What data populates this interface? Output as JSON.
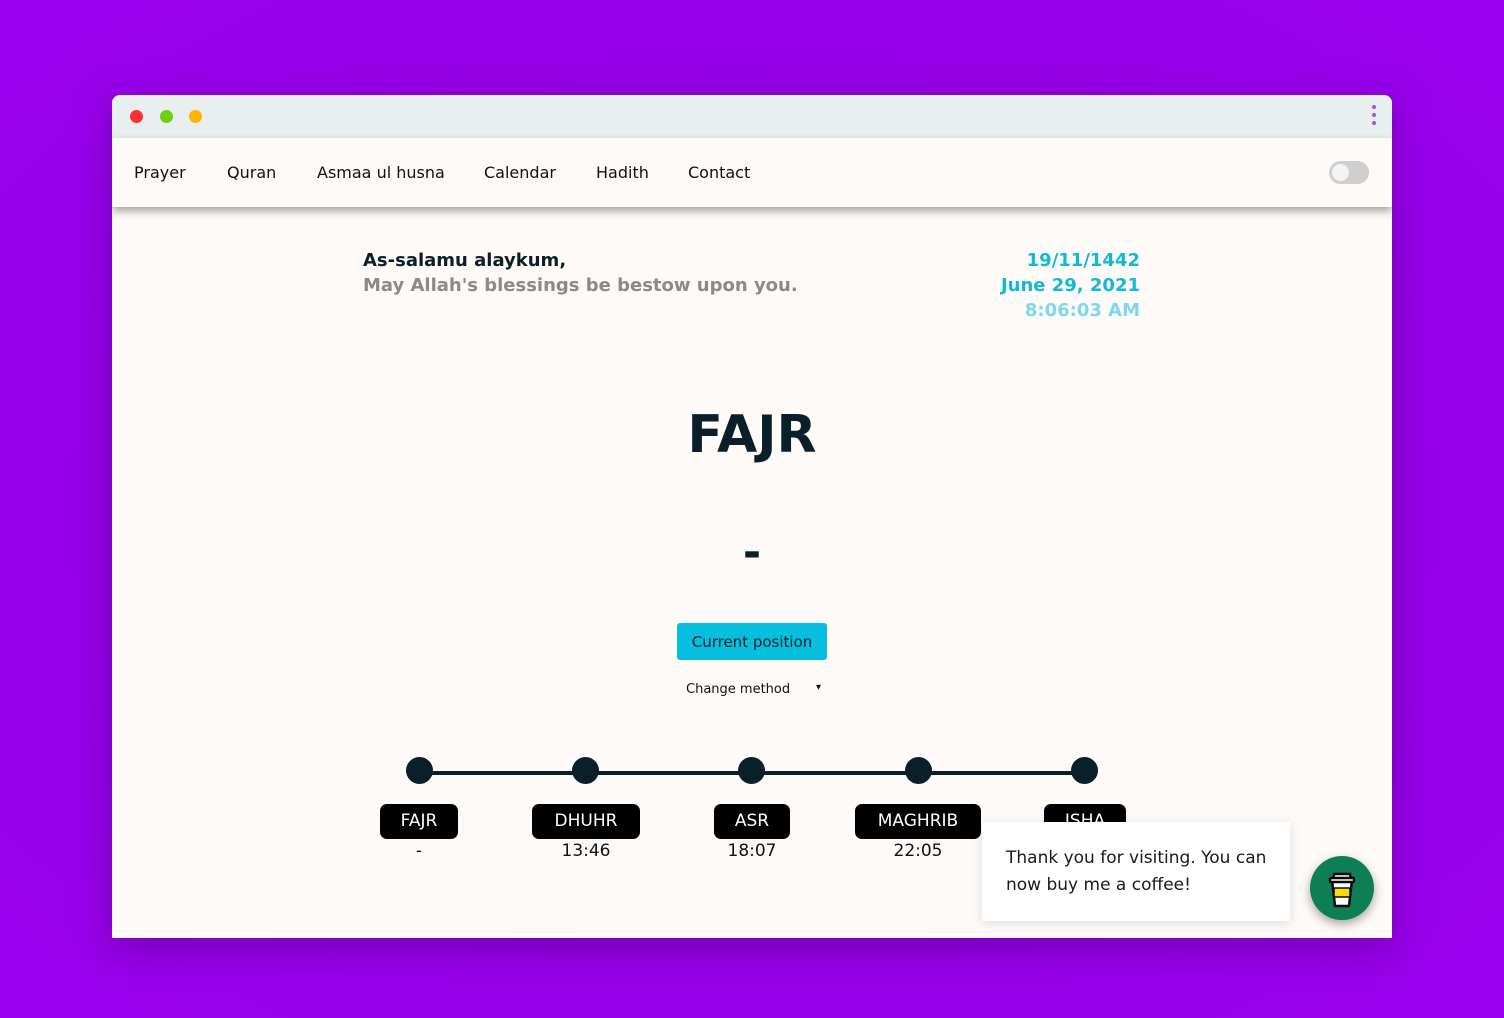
{
  "nav": {
    "items": [
      "Prayer",
      "Quran",
      "Asmaa ul husna",
      "Calendar",
      "Hadith",
      "Contact"
    ]
  },
  "greeting": {
    "line1": "As-salamu alaykum,",
    "line2": "May Allah's blessings be bestow upon you."
  },
  "datetime": {
    "hijri": "19/11/1442",
    "gregorian": "June 29, 2021",
    "time": "8:06:03 AM"
  },
  "current_prayer": {
    "name": "FAJR",
    "countdown": "-"
  },
  "controls": {
    "position_button": "Current position",
    "method_label": "Change method",
    "method_arrow": "▾"
  },
  "timeline": [
    {
      "name": "FAJR",
      "time": "-"
    },
    {
      "name": "DHUHR",
      "time": "13:46"
    },
    {
      "name": "ASR",
      "time": "18:07"
    },
    {
      "name": "MAGHRIB",
      "time": "22:05"
    },
    {
      "name": "ISHA",
      "time": ""
    }
  ],
  "popup": {
    "text": "Thank you for visiting. You can now buy me a coffee!"
  },
  "colors": {
    "background": "#9b00ee",
    "accent": "#06bfdf",
    "dark": "#0b1f2a",
    "coffee": "#0e7e57"
  },
  "icons": {
    "coffee_button": "coffee-cup-icon",
    "menu": "kebab-menu-icon"
  }
}
